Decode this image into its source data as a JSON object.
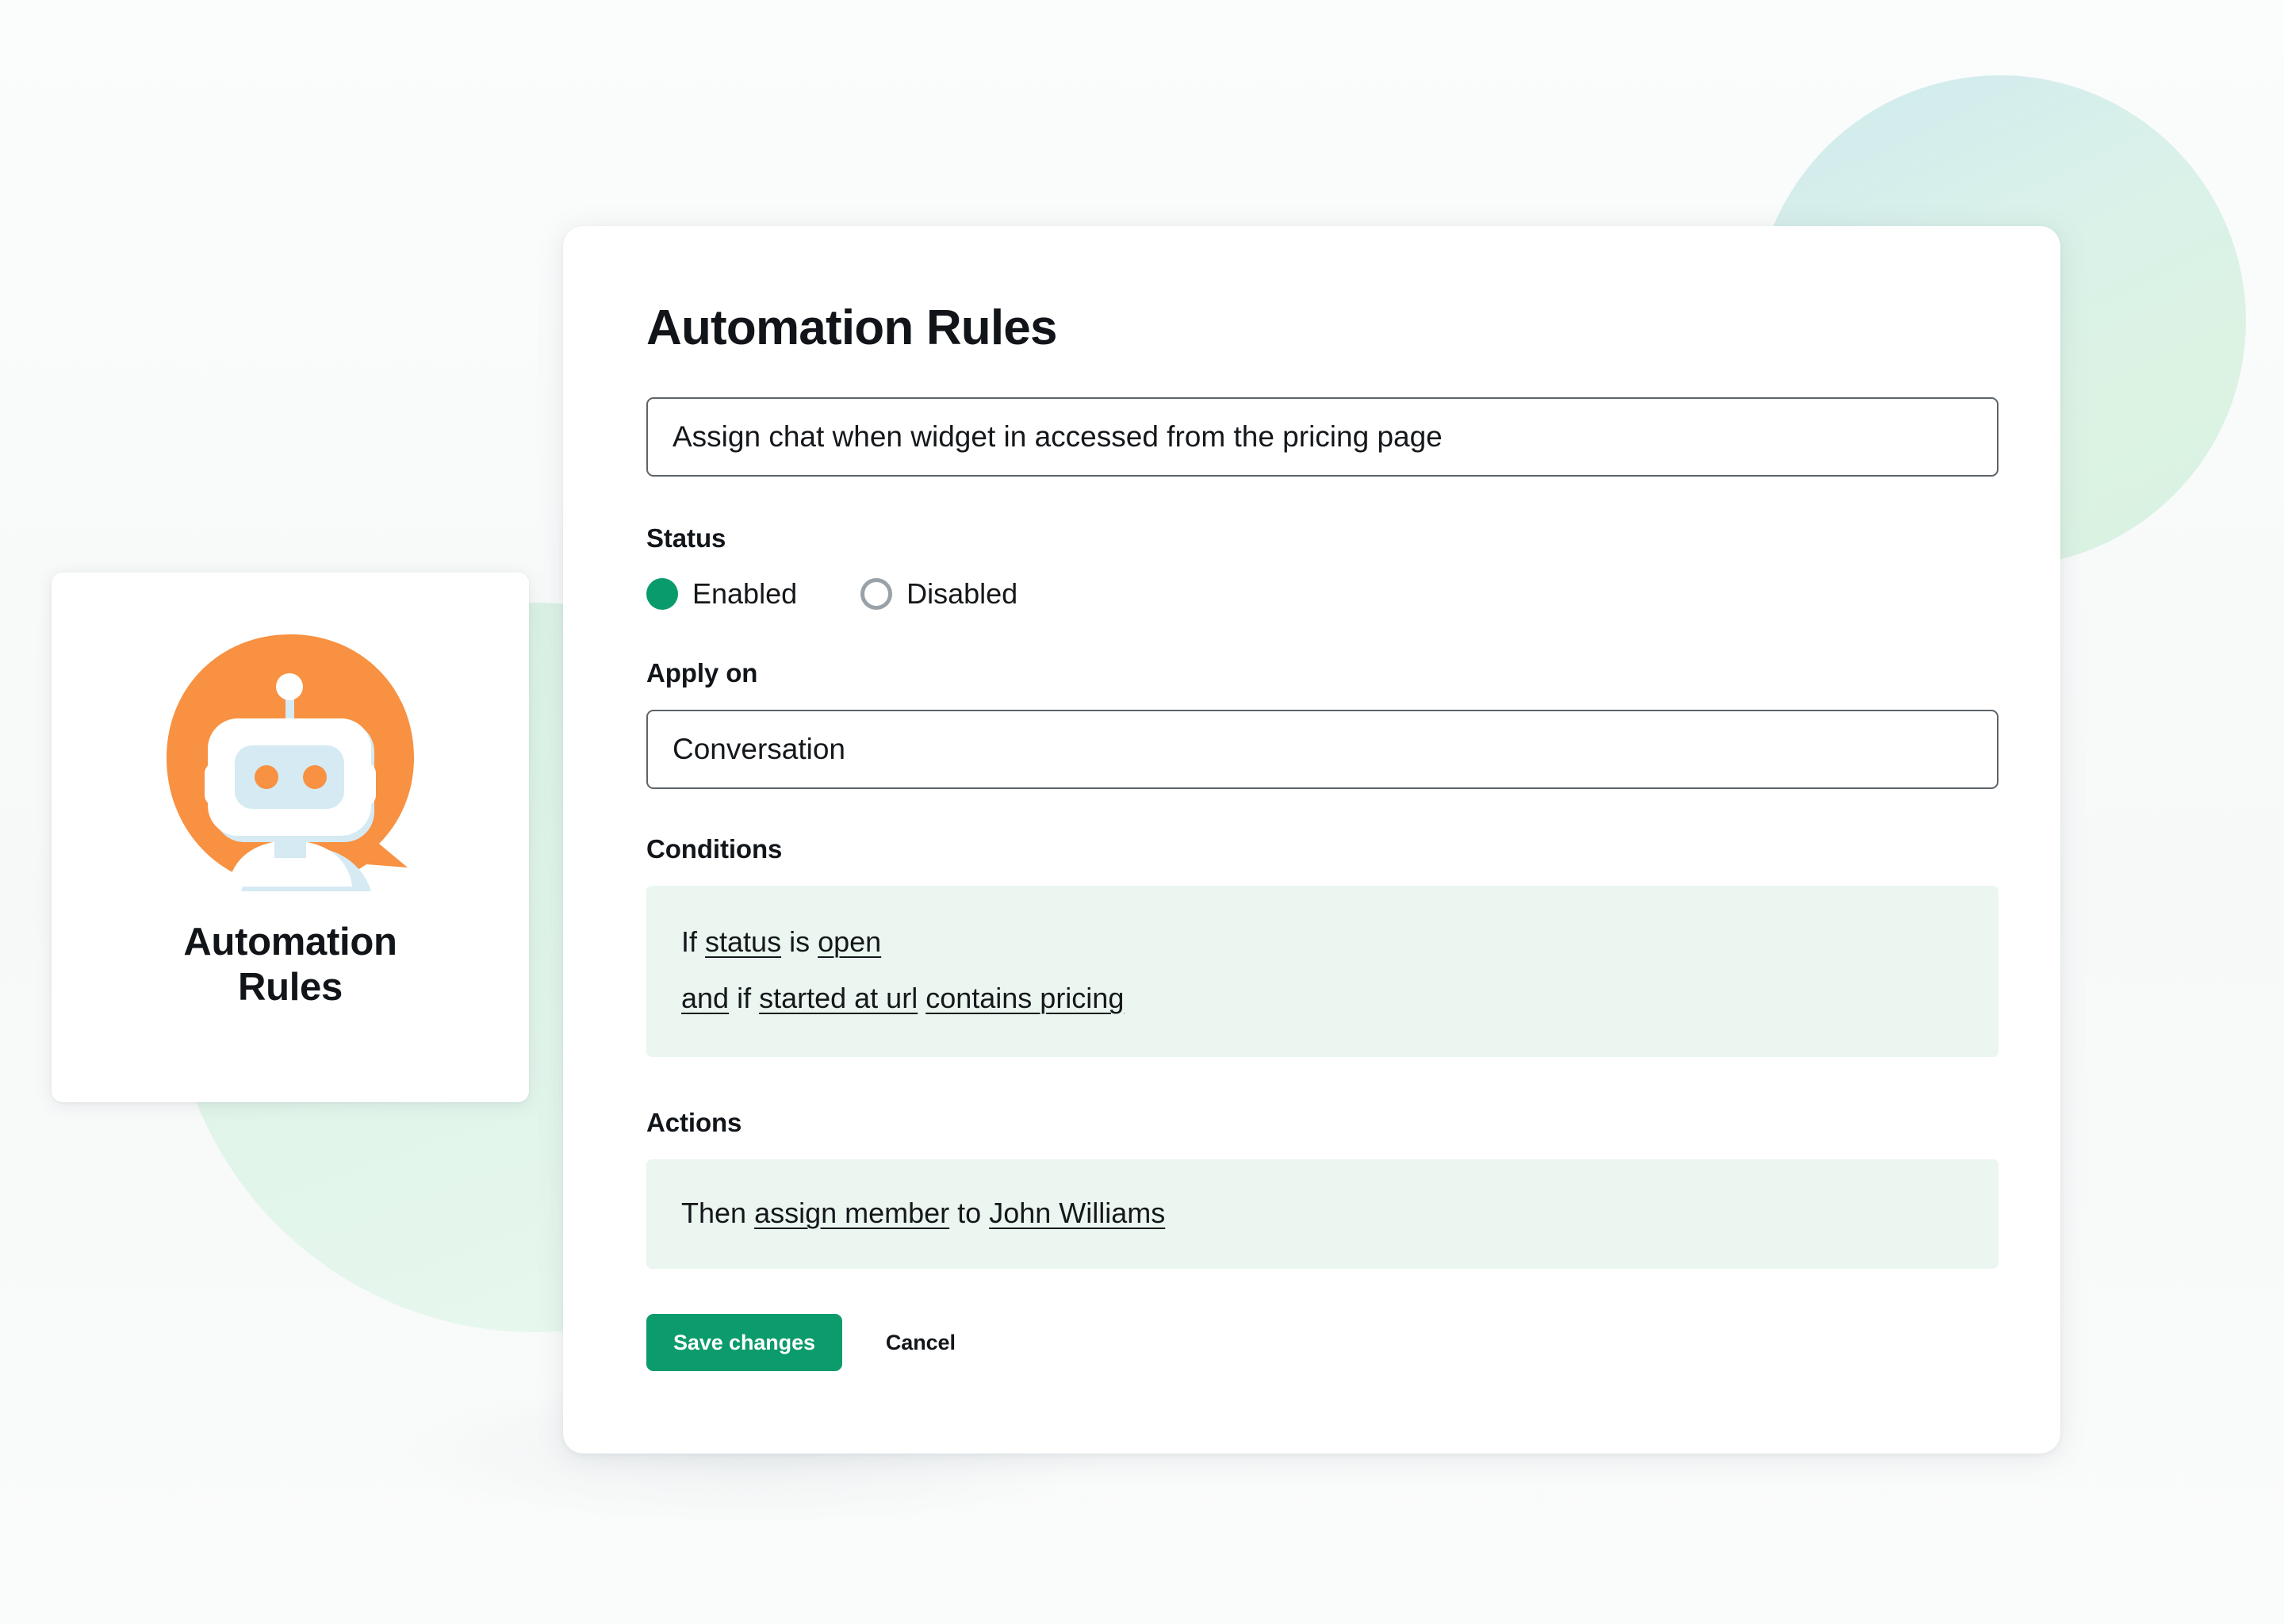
{
  "theme": {
    "accent_green": "#0C9B6C",
    "robot_orange": "#F89141",
    "robot_light_blue": "#D5EAF3",
    "condition_box_bg": "#EAF6EF",
    "page_bg": "#F8F9FA"
  },
  "icon_card": {
    "icon_name": "robot-chat-bubble-icon",
    "title": "Automation\nRules",
    "title_line1": "Automation",
    "title_line2": "Rules"
  },
  "panel": {
    "title": "Automation Rules",
    "rule_name": {
      "value": "Assign chat when widget in accessed from the pricing page",
      "placeholder": "Rule name"
    },
    "status": {
      "label": "Status",
      "selected": "Enabled",
      "options": [
        {
          "label": "Enabled",
          "checked": true
        },
        {
          "label": "Disabled",
          "checked": false
        }
      ]
    },
    "apply_on": {
      "label": "Apply on",
      "value": "Conversation"
    },
    "conditions": {
      "label": "Conditions",
      "lines": [
        {
          "parts": [
            {
              "text": "If ",
              "token": false
            },
            {
              "text": "status",
              "token": true
            },
            {
              "text": " is ",
              "token": false
            },
            {
              "text": "open",
              "token": true
            }
          ]
        },
        {
          "parts": [
            {
              "text": "and",
              "token": true
            },
            {
              "text": " if ",
              "token": false
            },
            {
              "text": "started at url",
              "token": true
            },
            {
              "text": " ",
              "token": false
            },
            {
              "text": "contains pricing",
              "token": true
            }
          ]
        }
      ],
      "line1_prefix": "If ",
      "line1_field": "status",
      "line1_operator": " is ",
      "line1_value": "open",
      "line2_conjunction": "and",
      "line2_if": " if ",
      "line2_field": "started at url",
      "line2_value": "contains pricing"
    },
    "actions": {
      "label": "Actions",
      "line_prefix": "Then ",
      "action_field": "assign member",
      "line_connector": " to ",
      "action_value": "John Williams"
    },
    "buttons": {
      "save_label": "Save changes",
      "cancel_label": "Cancel"
    }
  }
}
